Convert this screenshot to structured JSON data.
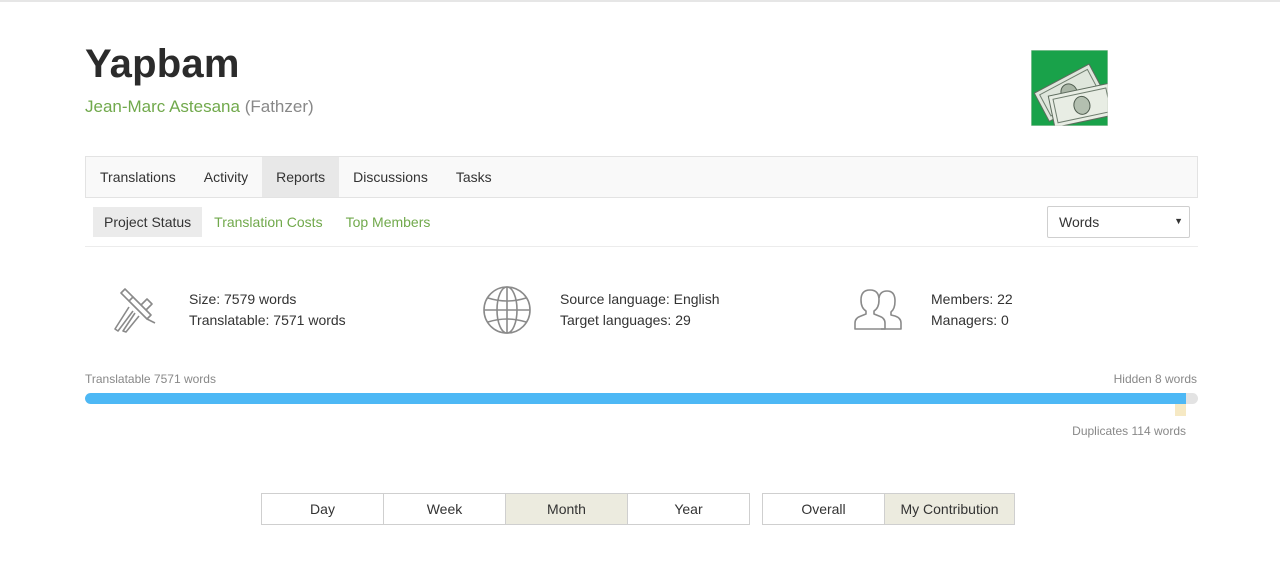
{
  "project": {
    "title": "Yapbam",
    "owner_name": "Jean-Marc Astesana",
    "owner_username": "(Fathzer)"
  },
  "logo": {
    "icon": "money-bills-icon",
    "bg_color": "#19a24a"
  },
  "tabs": [
    {
      "label": "Translations",
      "active": false
    },
    {
      "label": "Activity",
      "active": false
    },
    {
      "label": "Reports",
      "active": true
    },
    {
      "label": "Discussions",
      "active": false
    },
    {
      "label": "Tasks",
      "active": false
    }
  ],
  "subnav": [
    {
      "label": "Project Status",
      "active": true
    },
    {
      "label": "Translation Costs",
      "active": false
    },
    {
      "label": "Top Members",
      "active": false
    }
  ],
  "unit_select": {
    "value": "Words"
  },
  "stats": {
    "size": {
      "icon": "caliper-icon",
      "line1": "Size: 7579 words",
      "line2": "Translatable: 7571 words"
    },
    "languages": {
      "icon": "globe-icon",
      "line1": "Source language: English",
      "line2": "Target languages: 29"
    },
    "members": {
      "icon": "users-icon",
      "line1": "Members: 22",
      "line2": "Managers: 0"
    }
  },
  "progress": {
    "translatable_label": "Translatable 7571 words",
    "hidden_label": "Hidden 8 words",
    "duplicates_label": "Duplicates 114 words",
    "translatable_words": 7571,
    "hidden_words": 8,
    "duplicate_words": 114,
    "total_words": 7579,
    "fill_color": "#4db8f5",
    "duplicate_color": "#f6e9c4"
  },
  "period_buttons": [
    {
      "label": "Day",
      "active": false
    },
    {
      "label": "Week",
      "active": false
    },
    {
      "label": "Month",
      "active": true
    },
    {
      "label": "Year",
      "active": false
    }
  ],
  "scope_buttons": [
    {
      "label": "Overall",
      "active": false
    },
    {
      "label": "My Contribution",
      "active": true
    }
  ],
  "colors": {
    "accent_green": "#71a94c",
    "active_tab_bg": "#e8e8e8"
  }
}
